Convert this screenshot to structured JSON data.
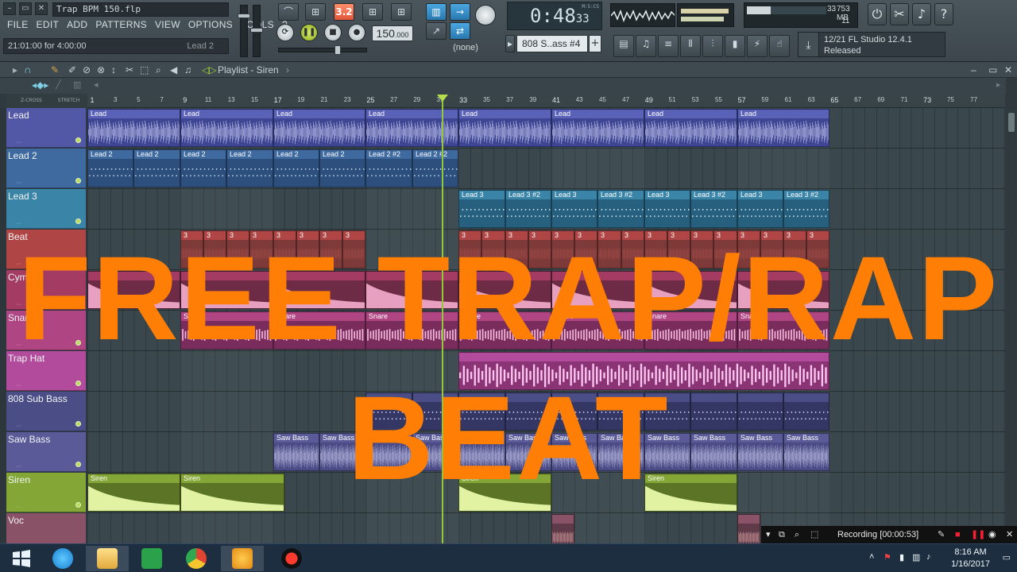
{
  "window": {
    "file_title": "Trap BPM 150.flp",
    "hint_text": "21:01:00 for 4:00:00",
    "hint_right": "Lead 2"
  },
  "menu": [
    "FILE",
    "EDIT",
    "ADD",
    "PATTERNS",
    "VIEW",
    "OPTIONS",
    "TOOLS",
    "?"
  ],
  "transport": {
    "pattern_song_badge": "3.2",
    "tempo_main": "150",
    "tempo_fraction": ".000",
    "time_main": "0:48",
    "time_sub": "33",
    "time_tag": "M:S:CS",
    "snap": "(none)"
  },
  "cpu": {
    "value": "33",
    "memory": "753 MB",
    "polyphony": "11"
  },
  "pattern": {
    "name": "808 S..ass #4",
    "add": "+"
  },
  "news": {
    "line1": "12/21  FL Studio 12.4.1",
    "line2": "Released"
  },
  "playlist": {
    "title": "Playlist - Siren",
    "arrow": "›",
    "zcross": "Z-CROSS",
    "stretch": "STRETCH"
  },
  "ruler_ticks": [
    "1",
    "3",
    "5",
    "7",
    "9",
    "11",
    "13",
    "15",
    "17",
    "19",
    "21",
    "23",
    "25",
    "27",
    "29",
    "31",
    "33",
    "35",
    "37",
    "39",
    "41",
    "43",
    "45",
    "47",
    "49",
    "51",
    "53",
    "55",
    "57",
    "59",
    "61",
    "63",
    "65",
    "67",
    "69",
    "71",
    "73",
    "75",
    "77"
  ],
  "tracks": [
    {
      "name": "Lead",
      "color": "#5257a6"
    },
    {
      "name": "Lead 2",
      "color": "#3f6aa0"
    },
    {
      "name": "Lead 3",
      "color": "#3a84a8"
    },
    {
      "name": "Beat",
      "color": "#b04545"
    },
    {
      "name": "Cymbal",
      "color": "#a33b62"
    },
    {
      "name": "Snare",
      "color": "#b04583"
    },
    {
      "name": "Trap Hat",
      "color": "#b24b9c"
    },
    {
      "name": "808 Sub Bass",
      "color": "#4b4d86"
    },
    {
      "name": "Saw Bass",
      "color": "#5a5a98"
    },
    {
      "name": "Siren",
      "color": "#84a636"
    },
    {
      "name": "Voc",
      "color": "#8a5267"
    }
  ],
  "clip_labels": {
    "lead": "Lead",
    "lead2": "Lead 2",
    "lead2b": "Lead 2 #2",
    "lead3": "Lead 3",
    "lead3b": "Lead 3 #2",
    "beat": "3",
    "cymbal": "",
    "snare": "Snare",
    "trap_hat": "",
    "sub": "",
    "saw": "Saw Bass",
    "siren": "Siren",
    "voc": ""
  },
  "overlay": {
    "line1": "FREE TRAP/RAP",
    "line2": "BEAT"
  },
  "recording": {
    "label": "Recording [00:00:53]"
  },
  "taskbar": {
    "time": "8:16 AM",
    "date": "1/16/2017"
  }
}
